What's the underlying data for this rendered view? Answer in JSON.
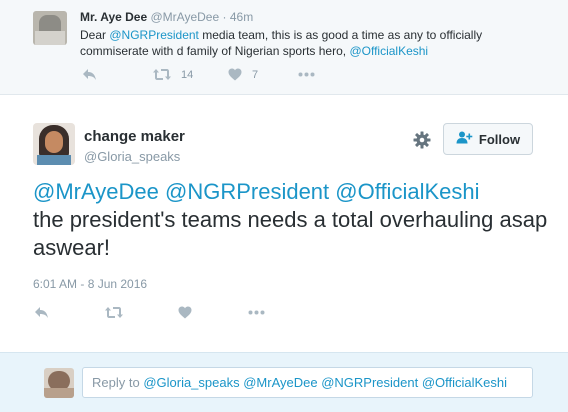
{
  "parent_tweet": {
    "author_name": "Mr. Aye Dee",
    "author_handle": "@MrAyeDee",
    "separator": "·",
    "time": "46m",
    "text_prefix": "Dear ",
    "mention_1": "@NGRPresident",
    "text_middle": " media team, this is as good a time as any to officially commiserate with d family of Nigerian sports hero, ",
    "mention_2": "@OfficialKeshi",
    "retweet_count": "14",
    "like_count": "7"
  },
  "main_tweet": {
    "author_name": "change maker",
    "author_handle": "@Gloria_speaks",
    "follow_label": "Follow",
    "mention_1": "@MrAyeDee",
    "mention_2": "@NGRPresident",
    "mention_3": "@OfficialKeshi",
    "text_line": "the president's teams needs a total overhauling asap aswear!",
    "timestamp": "6:01 AM - 8 Jun 2016"
  },
  "reply_box": {
    "prefix": "Reply to ",
    "mentions": "@Gloria_speaks @MrAyeDee @NGRPresident @OfficialKeshi"
  },
  "icons": {
    "reply": "reply-icon",
    "retweet": "retweet-icon",
    "like": "heart-icon",
    "more": "more-icon",
    "settings": "gear-icon",
    "follow": "add-user-icon"
  },
  "colors": {
    "link": "#1b95c8",
    "muted": "#8899a6",
    "icon": "#aab8c2",
    "reply_bg": "#e8f4fb"
  }
}
